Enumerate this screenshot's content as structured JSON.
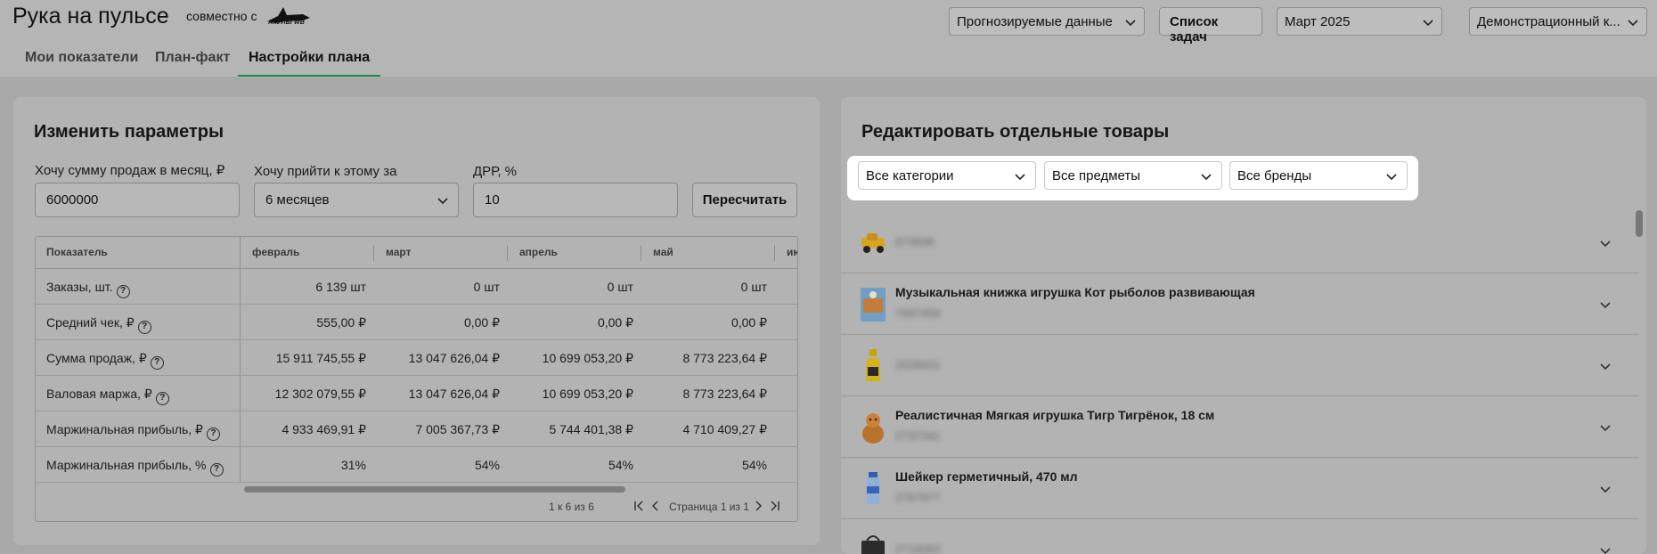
{
  "header": {
    "app_title": "Рука на пульсе",
    "partner_label": "совместно с",
    "partner_logo_text": "АКУЛЫ WB",
    "forecast_select": "Прогнозируемые данные",
    "tasks_button": "Список задач",
    "month_select": "Март 2025",
    "account_select": "Демонстрационный к..."
  },
  "tabs": [
    {
      "label": "Мои показатели"
    },
    {
      "label": "План-факт"
    },
    {
      "label": "Настройки плана"
    }
  ],
  "left_panel": {
    "title": "Изменить параметры",
    "sales_label": "Хочу сумму продаж в месяц, ₽",
    "sales_value": "6000000",
    "period_label": "Хочу прийти к этому за",
    "period_value": "6 месяцев",
    "drr_label": "ДРР, %",
    "drr_value": "10",
    "recalc_button": "Пересчитать",
    "table": {
      "columns": [
        "Показатель",
        "февраль",
        "март",
        "апрель",
        "май",
        "ию"
      ],
      "rows": [
        {
          "name": "Заказы, шт.",
          "values": [
            "6 139 шт",
            "0 шт",
            "0 шт",
            "0 шт"
          ]
        },
        {
          "name": "Средний чек, ₽",
          "values": [
            "555,00 ₽",
            "0,00 ₽",
            "0,00 ₽",
            "0,00 ₽"
          ]
        },
        {
          "name": "Сумма продаж, ₽",
          "values": [
            "15 911 745,55 ₽",
            "13 047 626,04 ₽",
            "10 699 053,20 ₽",
            "8 773 223,64 ₽"
          ]
        },
        {
          "name": "Валовая маржа, ₽",
          "values": [
            "12 302 079,55 ₽",
            "13 047 626,04 ₽",
            "10 699 053,20 ₽",
            "8 773 223,64 ₽"
          ]
        },
        {
          "name": "Маржинальная прибыль, ₽",
          "values": [
            "4 933 469,91 ₽",
            "7 005 367,73 ₽",
            "5 744 401,38 ₽",
            "4 710 409,27 ₽"
          ]
        },
        {
          "name": "Маржинальная прибыль, %",
          "values": [
            "31%",
            "54%",
            "54%",
            "54%"
          ]
        }
      ],
      "pagination_range": "1 к 6 из 6",
      "pagination_page": "Страница 1 из 1"
    }
  },
  "right_panel": {
    "title": "Редактировать отдельные товары",
    "filter_categories": "Все категории",
    "filter_subjects": "Все предметы",
    "filter_brands": "Все бренды",
    "products": [
      {
        "name": "",
        "sku": "873838",
        "image": "toy-car-image"
      },
      {
        "name": "Музыкальная книжка игрушка Кот рыболов развивающая",
        "sku": "7697459",
        "image": "book-toy-image"
      },
      {
        "name": "",
        "sku": "2028421",
        "image": "bottle-image"
      },
      {
        "name": "Реалистичная Мягкая игрушка Тигр Тигрёнок, 18 см",
        "sku": "2737341",
        "image": "tiger-toy-image"
      },
      {
        "name": "Шейкер герметичный, 470 мл",
        "sku": "2767977",
        "image": "shaker-image"
      },
      {
        "name": "",
        "sku": "2716063",
        "image": "bag-image"
      }
    ]
  },
  "colors": {
    "accent": "#1f8a4c",
    "overlay_background": "#a9a9a9",
    "highlight": "#ffffff"
  }
}
